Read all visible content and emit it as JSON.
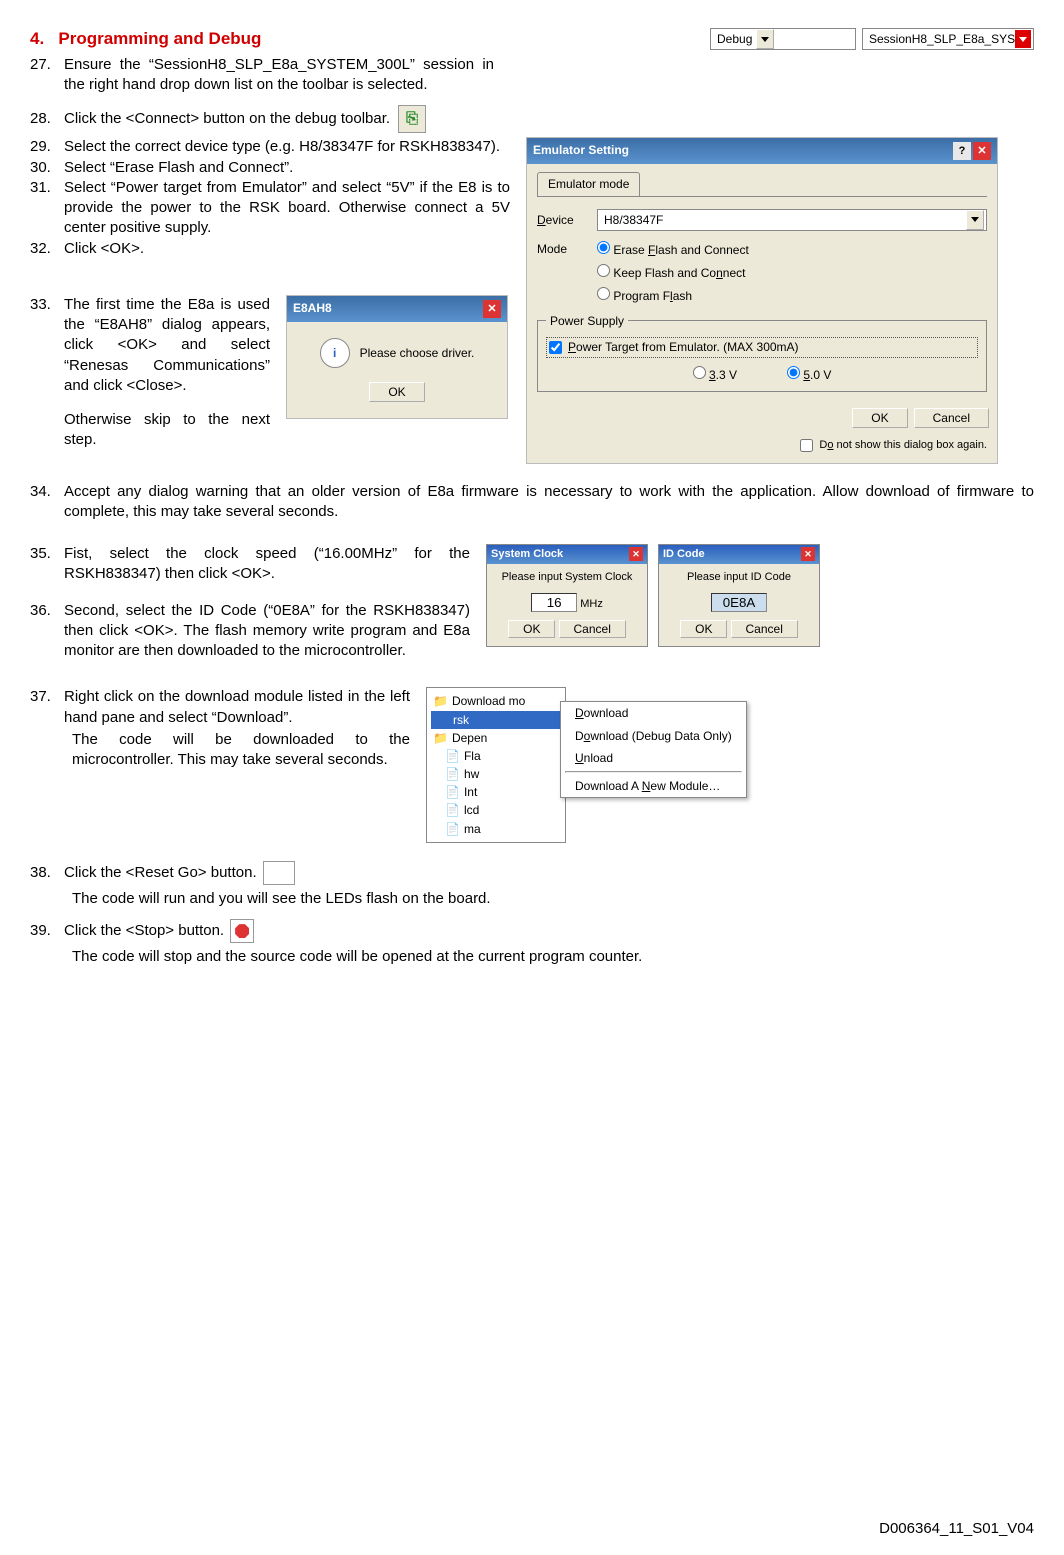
{
  "section": {
    "num": "4.",
    "title": "Programming and Debug"
  },
  "toolbar": {
    "combo1": "Debug",
    "combo2": "SessionH8_SLP_E8a_SYS"
  },
  "steps": {
    "s27": {
      "n": "27.",
      "t": "Ensure the “SessionH8_SLP_E8a_SYSTEM_300L” session in the right hand drop down list on the toolbar is selected."
    },
    "s28": {
      "n": "28.",
      "t": "Click the <Connect> button on the debug toolbar."
    },
    "s29": {
      "n": "29.",
      "t": "Select the correct device type (e.g. H8/38347F for RSKH838347)."
    },
    "s30": {
      "n": "30.",
      "t": "Select “Erase Flash and Connect”."
    },
    "s31": {
      "n": "31.",
      "t": "Select “Power target from Emulator” and select “5V” if the E8 is to provide the power to the RSK board. Otherwise connect a 5V center positive supply."
    },
    "s32": {
      "n": "32.",
      "t": "Click <OK>."
    },
    "s33": {
      "n": "33.",
      "t1": "The first time the E8a is used the “E8AH8” dialog appears, click <OK> and select “Renesas Communications” and click <Close>.",
      "t2": "Otherwise skip to the next step."
    },
    "s34": {
      "n": "34.",
      "t": "Accept any dialog warning that an older version of E8a firmware is necessary to work with the application. Allow download of firmware to complete, this may take several seconds."
    },
    "s35": {
      "n": "35.",
      "t": "Fist, select the clock speed (“16.00MHz” for the RSKH838347) then click <OK>."
    },
    "s36": {
      "n": "36.",
      "t": "Second, select the ID Code (“0E8A” for the RSKH838347) then click <OK>. The flash memory write program and E8a monitor are then downloaded to the microcontroller."
    },
    "s37": {
      "n": "37.",
      "t1": "Right click on the download module listed in the left hand pane and select “Download”.",
      "t2": "The code will be downloaded to the microcontroller. This may take several seconds."
    },
    "s38": {
      "n": "38.",
      "t1": "Click the <Reset Go> button.",
      "t2": "The code will run and you will see the LEDs flash on the board."
    },
    "s39": {
      "n": "39.",
      "t1": "Click the <Stop> button.",
      "t2": "The code will stop and the source code will be opened at the current program counter."
    }
  },
  "emulator_dialog": {
    "title": "Emulator Setting",
    "tab": "Emulator mode",
    "device_label": "Device",
    "device_value": "H8/38347F",
    "mode_label": "Mode",
    "mode_opts": [
      "Erase Flash and Connect",
      "Keep Flash and Connect",
      "Program Flash"
    ],
    "power_group": "Power Supply",
    "power_check": "Power Target from Emulator. (MAX 300mA)",
    "v33": "3.3 V",
    "v50": "5.0 V",
    "ok": "OK",
    "cancel": "Cancel",
    "dont_show": "Do not show this dialog box again."
  },
  "e8ah8_dialog": {
    "title": "E8AH8",
    "msg": "Please choose driver.",
    "ok": "OK"
  },
  "sysclock_dialog": {
    "title": "System Clock",
    "prompt": "Please input System Clock",
    "value": "16",
    "unit": "MHz",
    "ok": "OK",
    "cancel": "Cancel"
  },
  "idcode_dialog": {
    "title": "ID Code",
    "prompt": "Please input ID Code",
    "value": "0E8A",
    "ok": "OK",
    "cancel": "Cancel"
  },
  "tree": {
    "items": [
      "Download mo",
      "rsk",
      "Depen",
      "Fla",
      "hw",
      "Int",
      "lcd",
      "ma"
    ]
  },
  "context_menu": {
    "items": [
      "Download",
      "Download (Debug Data Only)",
      "Unload",
      "Download A New Module…"
    ]
  },
  "footer": "D006364_11_S01_V04"
}
